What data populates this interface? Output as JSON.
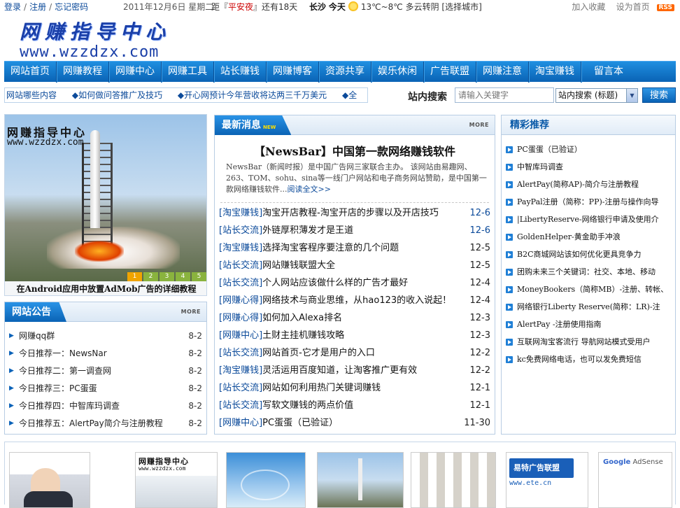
{
  "topbar": {
    "login": "登录",
    "register": "注册",
    "forgot": "忘记密码",
    "sep": "/",
    "date": "2011年12月6日 星期二",
    "countdown_prefix": "距『",
    "countdown_event": "平安夜",
    "countdown_suffix": "』还有18天",
    "city": "长沙",
    "today": "今天",
    "weather": "13℃~8℃ 多云转阴",
    "choose_city": "[选择城市]",
    "favorite": "加入收藏",
    "homepage": "设为首页",
    "rss": "RSS"
  },
  "logo": {
    "title": "网赚指导中心",
    "url": "www.wzzdzx.com"
  },
  "nav": {
    "items": [
      "网站首页",
      "网赚教程",
      "网赚中心",
      "网赚工具",
      "站长赚钱",
      "网赚博客",
      "资源共享",
      "娱乐休闲",
      "广告联盟",
      "网赚注意",
      "淘宝赚钱",
      "留言本"
    ]
  },
  "ticker": {
    "items": [
      "网站哪些内容",
      "◆如何做问答推广及技巧",
      "◆开心网预计今年营收将达两三千万美元",
      "◆全"
    ]
  },
  "search": {
    "label": "站内搜索",
    "placeholder": "请输入关键字",
    "select_value": "站内搜索 (标题)",
    "button": "搜索"
  },
  "slideshow": {
    "watermark_title": "网赚指导中心",
    "watermark_url": "www.wzzdzx.com",
    "caption": "在Android应用中放置AdMob广告的详细教程",
    "pages": [
      "1",
      "2",
      "3",
      "4",
      "5"
    ],
    "active_page": 1
  },
  "notice": {
    "title": "网站公告",
    "more": "MORE",
    "items": [
      {
        "text": "网赚qq群",
        "date": "8-2"
      },
      {
        "text": "今日推荐一：NewsNar",
        "date": "8-2"
      },
      {
        "text": "今日推荐二：第一调查网",
        "date": "8-2"
      },
      {
        "text": "今日推荐三：PC蛋蛋",
        "date": "8-2"
      },
      {
        "text": "今日推荐四：中智库玛调查",
        "date": "8-2"
      },
      {
        "text": "今日推荐五：AlertPay简介与注册教程",
        "date": "8-2"
      }
    ]
  },
  "news": {
    "title": "最新消息",
    "new_tag": "NEW",
    "more": "MORE",
    "headline": "【NewsBar】中国第一款网络赚钱软件",
    "summary": "NewsBar（新闻时报）是中国广告网三家联合主办。 该网站由易趣网、263、TOM、sohu、sina等一线门户网站和电子商务网站赞助，是中国第一款网络赚钱软件...",
    "read_more": "阅读全文>>",
    "items": [
      {
        "cat": "[淘宝赚钱]",
        "text": "淘宝开店教程-淘宝开店的步骤以及开店技巧",
        "date": "12-6"
      },
      {
        "cat": "[站长交流]",
        "text": "外链厚积薄发才是王道",
        "date": "12-6"
      },
      {
        "cat": "[淘宝赚钱]",
        "text": "选择淘宝客程序要注意的几个问题",
        "date": "12-5"
      },
      {
        "cat": "[站长交流]",
        "text": "网站赚钱联盟大全",
        "date": "12-5"
      },
      {
        "cat": "[站长交流]",
        "text": "个人网站应该做什么样的广告才最好",
        "date": "12-4"
      },
      {
        "cat": "[网赚心得]",
        "text": "网络技术与商业思维，从hao123的收入说起！",
        "date": "12-4"
      },
      {
        "cat": "[网赚心得]",
        "text": "如何加入Alexa排名",
        "date": "12-3"
      },
      {
        "cat": "[网赚中心]",
        "text": "土财主挂机赚钱攻略",
        "date": "12-3"
      },
      {
        "cat": "[站长交流]",
        "text": "网站首页-它才是用户的入口",
        "date": "12-2"
      },
      {
        "cat": "[淘宝赚钱]",
        "text": "灵活运用百度知道，让淘客推广更有效",
        "date": "12-2"
      },
      {
        "cat": "[站长交流]",
        "text": "网站如何利用热门关键词赚钱",
        "date": "12-1"
      },
      {
        "cat": "[站长交流]",
        "text": "写软文赚钱的两点价值",
        "date": "12-1"
      },
      {
        "cat": "[网赚中心]",
        "text": "PC蛋蛋（已验证）",
        "date": "11-30"
      }
    ]
  },
  "recommend": {
    "title": "精彩推荐",
    "items": [
      "PC蛋蛋（已验证）",
      "中智库玛调查",
      "AlertPay(简称AP)-简介与注册教程",
      "PayPal注册（简称：PP)-注册与操作向导",
      "|LibertyReserve-网络银行申请及使用介",
      "GoldenHelper-黄金助手冲浪",
      "B2C商城网站该如何优化更具竞争力",
      "团购未来三个关键词：社交、本地、移动",
      "MoneyBookers（简称MB）-注册、转帐、",
      "网络银行Liberty Reserve(简称：LR)-注",
      "AlertPay -注册使用指南",
      "互联网淘宝客流行 导航网站模式受用户",
      "kc免费网络电话，也可以发免费短信"
    ]
  },
  "thumbs": {
    "logo_title": "网赚指导中心",
    "logo_url": "www.wzzdzx.com",
    "etc_brand": "易特广告联盟",
    "etc_url": "www.ete.cn",
    "ga_brand_1": "Google",
    "ga_brand_2": "AdSense"
  }
}
